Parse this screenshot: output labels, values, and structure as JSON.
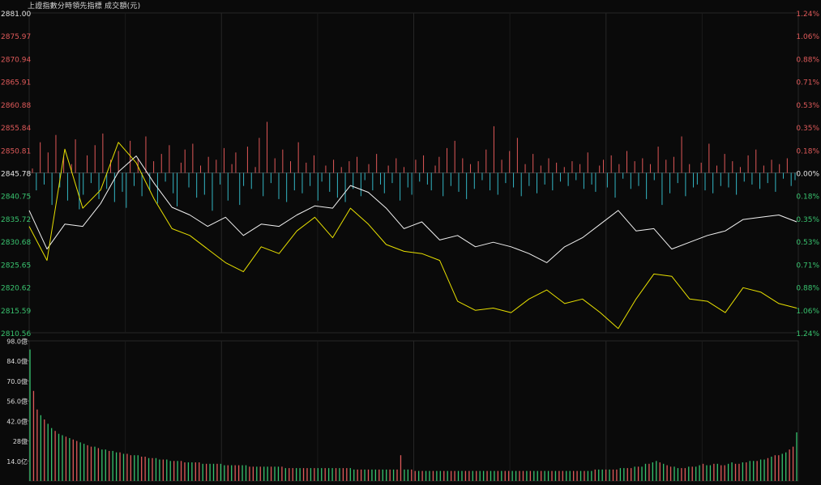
{
  "header": {
    "title": "上證指數分時領先指標 成交額(元)"
  },
  "colors": {
    "background": "#0a0a0a",
    "grid": "#262626",
    "white_line": "#f2f2f2",
    "yellow_line": "#e8e000",
    "up": "#e05858",
    "down": "#33b6c4",
    "vol_up": "#e05a5a",
    "vol_down": "#36c36e",
    "label_red": "#e05a5a",
    "label_green": "#39c46f"
  },
  "chart_data": [
    {
      "type": "line",
      "name": "price-panel",
      "ylim": [
        2810.56,
        2881.0
      ],
      "base_price": 2845.78,
      "y_ticks_left": [
        {
          "value": 2881.0,
          "label": "2881.00"
        },
        {
          "value": 2875.97,
          "label": "2875.97"
        },
        {
          "value": 2870.94,
          "label": "2870.94"
        },
        {
          "value": 2865.91,
          "label": "2865.91"
        },
        {
          "value": 2860.88,
          "label": "2860.88"
        },
        {
          "value": 2855.84,
          "label": "2855.84"
        },
        {
          "value": 2850.81,
          "label": "2850.81"
        },
        {
          "value": 2845.78,
          "label": "2845.78"
        },
        {
          "value": 2840.75,
          "label": "2840.75"
        },
        {
          "value": 2835.72,
          "label": "2835.72"
        },
        {
          "value": 2830.68,
          "label": "2830.68"
        },
        {
          "value": 2825.65,
          "label": "2825.65"
        },
        {
          "value": 2820.62,
          "label": "2820.62"
        },
        {
          "value": 2815.59,
          "label": "2815.59"
        },
        {
          "value": 2810.56,
          "label": "2810.56"
        }
      ],
      "y_ticks_right": [
        "1.24%",
        "1.06%",
        "0.88%",
        "0.71%",
        "0.53%",
        "0.35%",
        "0.18%",
        "0.00%",
        "0.18%",
        "0.35%",
        "0.53%",
        "0.71%",
        "0.88%",
        "1.06%",
        "1.24%"
      ],
      "x_minutes": [
        0,
        8,
        16,
        24,
        32,
        40,
        48,
        56,
        64,
        72,
        80,
        88,
        96,
        104,
        112,
        120,
        128,
        136,
        144,
        152,
        160,
        168,
        176,
        184,
        192,
        200,
        208,
        216,
        224,
        232,
        240
      ],
      "series": [
        {
          "color": "white",
          "values": [
            2837.5,
            2829.0,
            2834.5,
            2834.0,
            2839.0,
            2846.0,
            2849.5,
            2843.5,
            2838.2,
            2836.5,
            2834.0,
            2836.0,
            2832.0,
            2834.5,
            2834.0,
            2836.5,
            2838.5,
            2838.0,
            2843.0,
            2841.5,
            2838.0,
            2833.5,
            2835.0,
            2831.0,
            2832.0,
            2829.5,
            2830.5,
            2829.5,
            2828.0,
            2826.0,
            2829.5,
            2831.5,
            2834.5,
            2837.5,
            2833.0,
            2833.5,
            2829.0,
            2830.5,
            2832.0,
            2833.0,
            2835.5,
            2836.0,
            2836.5,
            2835.0
          ]
        },
        {
          "color": "yellow",
          "values": [
            2834.0,
            2826.5,
            2851.0,
            2838.0,
            2842.0,
            2852.5,
            2848.0,
            2840.0,
            2833.5,
            2832.0,
            2829.0,
            2826.0,
            2824.0,
            2829.5,
            2828.0,
            2833.0,
            2836.0,
            2831.5,
            2838.0,
            2834.5,
            2830.0,
            2828.5,
            2828.0,
            2826.5,
            2817.5,
            2815.5,
            2816.0,
            2815.0,
            2818.0,
            2820.0,
            2817.0,
            2818.0,
            2815.0,
            2811.5,
            2818.0,
            2823.5,
            2823.0,
            2818.0,
            2817.5,
            2815.0,
            2820.5,
            2819.5,
            2817.0,
            2816.0
          ]
        }
      ],
      "diff_bars": [
        0.3,
        -1.2,
        2.1,
        -0.8,
        1.4,
        -2.2,
        2.6,
        -1.0,
        1.1,
        -1.9,
        0.6,
        2.3,
        -2.5,
        -1.5,
        1.2,
        -0.7,
        1.9,
        -1.8,
        2.7,
        -1.1,
        0.9,
        -2.0,
        1.5,
        -1.3,
        -2.4,
        2.2,
        -0.9,
        1.0,
        -1.6,
        2.5,
        -1.2,
        0.8,
        -2.1,
        1.3,
        -0.6,
        1.9,
        -1.4,
        -2.3,
        0.7,
        1.6,
        -1.0,
        2.0,
        -1.7,
        0.5,
        -1.5,
        1.1,
        -2.6,
        0.9,
        -0.8,
        1.7,
        -1.9,
        0.6,
        1.4,
        -2.2,
        -0.9,
        1.8,
        -1.1,
        0.4,
        2.4,
        -1.6,
        3.5,
        -0.7,
        1.0,
        -1.8,
        1.6,
        -2.0,
        0.8,
        -1.2,
        2.1,
        -1.4,
        0.7,
        -0.9,
        1.2,
        -1.9,
        -0.6,
        0.5,
        -1.3,
        0.9,
        -1.7,
        0.4,
        -2.0,
        0.8,
        -1.1,
        1.1,
        -1.6,
        -0.5,
        0.6,
        -1.2,
        1.3,
        -0.8,
        -1.4,
        0.5,
        -0.7,
        1.0,
        -1.9,
        0.4,
        -1.0,
        -1.5,
        0.9,
        -0.6,
        1.2,
        -0.8,
        -1.2,
        0.5,
        1.1,
        -1.6,
        1.7,
        -0.9,
        2.2,
        -1.3,
        1.0,
        -1.8,
        0.6,
        -1.1,
        0.8,
        -0.5,
        1.6,
        -1.2,
        3.2,
        -1.5,
        0.9,
        -0.7,
        1.5,
        -1.0,
        2.4,
        -1.6,
        0.6,
        -0.9,
        1.3,
        -1.4,
        0.5,
        -0.8,
        1.0,
        -1.2,
        0.7,
        -0.6,
        0.4,
        -0.9,
        0.8,
        -0.5,
        0.6,
        -1.1,
        1.4,
        -0.8,
        -1.3,
        0.5,
        0.9,
        -1.0,
        1.2,
        -1.7,
        0.6,
        -0.4,
        1.5,
        -1.1,
        0.8,
        -0.9,
        1.0,
        -1.8,
        0.6,
        -0.5,
        1.8,
        -2.2,
        0.9,
        -1.4,
        1.1,
        -0.7,
        2.5,
        -1.6,
        0.6,
        -1.0,
        -0.8,
        0.7,
        -1.2,
        2.0,
        -1.4,
        0.5,
        -0.9,
        1.3,
        -1.0,
        0.8,
        -1.5,
        0.4,
        -0.6,
        1.2,
        -0.8,
        1.6,
        -1.1,
        0.5,
        -0.7,
        0.9,
        -1.3,
        0.6,
        -0.4,
        1.0,
        -0.9,
        -0.5
      ]
    },
    {
      "type": "bar",
      "name": "volume-panel",
      "ylim": [
        0,
        98
      ],
      "y_ticks": [
        {
          "value": 98,
          "label": "98.0億"
        },
        {
          "value": 84,
          "label": "84.0億"
        },
        {
          "value": 70,
          "label": "70.0億"
        },
        {
          "value": 56,
          "label": "56.0億"
        },
        {
          "value": 42,
          "label": "42.0億"
        },
        {
          "value": 28,
          "label": "28億"
        },
        {
          "value": 14,
          "label": "14.0亿"
        }
      ],
      "values": [
        92,
        63,
        50,
        46,
        43,
        40,
        37,
        35,
        33,
        32,
        31,
        30,
        29,
        28,
        27,
        26,
        25,
        24,
        24,
        23,
        22,
        22,
        21,
        21,
        20,
        20,
        19,
        19,
        18,
        18,
        18,
        17,
        17,
        16,
        16,
        16,
        15,
        15,
        15,
        14,
        14,
        14,
        14,
        13,
        13,
        13,
        13,
        13,
        12,
        12,
        12,
        12,
        12,
        12,
        11,
        11,
        11,
        11,
        11,
        11,
        11,
        10,
        10,
        10,
        10,
        10,
        10,
        10,
        10,
        10,
        10,
        9,
        9,
        9,
        9,
        9,
        9,
        9,
        9,
        9,
        9,
        9,
        9,
        9,
        9,
        9,
        9,
        9,
        9,
        9,
        8,
        8,
        8,
        8,
        8,
        8,
        8,
        8,
        8,
        8,
        8,
        8,
        8,
        18,
        8,
        8,
        8,
        7,
        7,
        7,
        7,
        7,
        7,
        7,
        7,
        7,
        7,
        7,
        7,
        7,
        7,
        7,
        7,
        7,
        7,
        7,
        7,
        7,
        7,
        7,
        7,
        7,
        7,
        7,
        7,
        7,
        7,
        7,
        7,
        7,
        7,
        7,
        7,
        7,
        7,
        7,
        7,
        7,
        7,
        7,
        7,
        7,
        7,
        7,
        7,
        7,
        7,
        8,
        8,
        8,
        8,
        8,
        8,
        8,
        9,
        9,
        9,
        9,
        10,
        10,
        10,
        12,
        12,
        13,
        14,
        13,
        12,
        11,
        10,
        10,
        9,
        9,
        9,
        10,
        10,
        10,
        11,
        12,
        11,
        11,
        12,
        12,
        11,
        11,
        12,
        13,
        12,
        12,
        13,
        13,
        14,
        14,
        14,
        15,
        15,
        16,
        17,
        18,
        18,
        19,
        20,
        22,
        24,
        34
      ],
      "colors": "alternating red/green by trade direction"
    }
  ]
}
